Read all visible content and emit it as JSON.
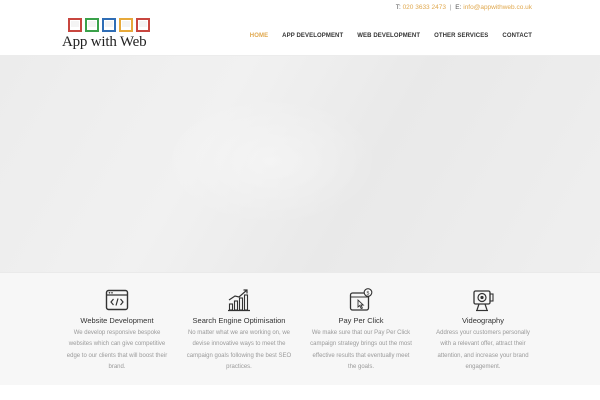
{
  "topbar": {
    "phone_label": "T:",
    "phone": "020 3633 2473",
    "separator": "|",
    "email_label": "E:",
    "email": "info@appwithweb.co.uk"
  },
  "brand": {
    "name": "App with Web",
    "frame_colors": [
      "#c8463f",
      "#3aa14a",
      "#2f6db5",
      "#e7a93a",
      "#c8463f"
    ]
  },
  "nav": {
    "items": [
      {
        "label": "HOME",
        "active": true
      },
      {
        "label": "APP DEVELOPMENT",
        "active": false
      },
      {
        "label": "WEB DEVELOPMENT",
        "active": false
      },
      {
        "label": "OTHER SERVICES",
        "active": false
      },
      {
        "label": "CONTACT",
        "active": false
      }
    ],
    "accent_color": "#e0a84e"
  },
  "services": [
    {
      "icon": "code-window-icon",
      "title": "Website Development",
      "lines": [
        "We develop responsive bespoke",
        "websites which can give competitive",
        "edge to our clients that will boost their",
        "brand."
      ]
    },
    {
      "icon": "growth-chart-icon",
      "title": "Search Engine Optimisation",
      "lines": [
        "No matter what we are working on, we",
        "devise innovative ways to meet the",
        "campaign goals following the best SEO",
        "practices."
      ]
    },
    {
      "icon": "pay-per-click-icon",
      "title": "Pay Per Click",
      "lines": [
        "We make sure that our Pay Per Click",
        "campaign strategy brings out the most",
        "effective results that eventually meet",
        "the goals."
      ]
    },
    {
      "icon": "video-camera-icon",
      "title": "Videography",
      "lines": [
        "Address your customers personally",
        "with a relevant offer, attract their",
        "attention, and increase your brand",
        "engagement."
      ]
    }
  ]
}
